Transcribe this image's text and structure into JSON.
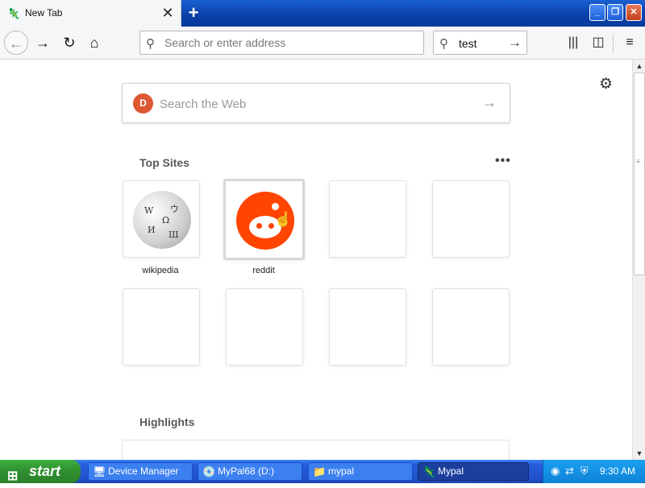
{
  "tab": {
    "title": "New Tab",
    "favicon": "mypal-icon",
    "close": "✕"
  },
  "newtab": "+",
  "window_controls": {
    "minimize": "_",
    "maximize": "❐",
    "close": "✕"
  },
  "nav": {
    "back": "←",
    "forward": "→",
    "reload": "↻",
    "home": "⌂",
    "address_placeholder": "Search or enter address",
    "search_value": "test",
    "search_go": "→",
    "library": "|||",
    "sidebar": "◫",
    "menu": "≡"
  },
  "newtab_page": {
    "web_search_placeholder": "Search the Web",
    "web_search_arrow": "→",
    "settings": "⚙",
    "top_sites_title": "Top Sites",
    "more": "•••",
    "top_sites": [
      {
        "label": "wikipedia"
      },
      {
        "label": "reddit"
      }
    ],
    "highlights_title": "Highlights"
  },
  "taskbar": {
    "start": "start",
    "tasks": [
      {
        "label": "Device Manager",
        "icon": "computer-icon"
      },
      {
        "label": "MyPal68 (D:)",
        "icon": "drive-icon"
      },
      {
        "label": "mypal",
        "icon": "folder-icon"
      },
      {
        "label": "Mypal",
        "icon": "mypal-icon"
      }
    ],
    "clock": "9:30 AM"
  }
}
